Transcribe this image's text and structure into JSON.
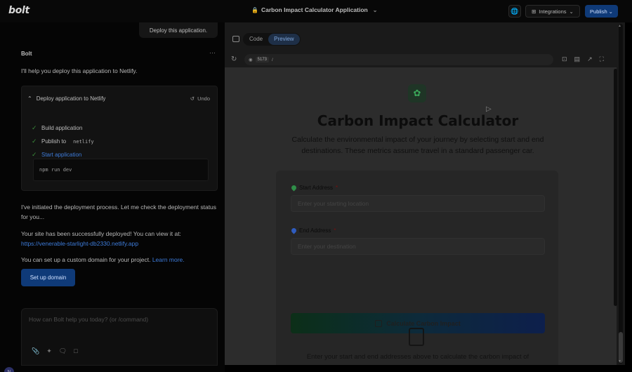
{
  "app": {
    "logo": "bolt"
  },
  "header": {
    "title": "Carbon Impact Calculator Application",
    "integrations_label": "Integrations",
    "publish_label": "Publish"
  },
  "chat": {
    "user_message": "Deploy this application.",
    "assistant_name": "Bolt",
    "intro": "I'll help you deploy this application to Netlify.",
    "action_card": {
      "title": "Deploy application to Netlify",
      "undo_label": "Undo",
      "steps": [
        {
          "label": "Build application",
          "code": ""
        },
        {
          "label": "Publish to",
          "code": "netlify"
        },
        {
          "label": "Start application",
          "code": ""
        }
      ],
      "command": "npm run dev"
    },
    "msg_initiated": "I've initiated the deployment process. Let me check the deployment status for you...",
    "msg_success": "Your site has been successfully deployed! You can view it at:",
    "site_url": "https://venerable-starlight-db2330.netlify.app",
    "msg_domain_prefix": "You can set up a custom domain for your project.",
    "learn_more": "Learn more.",
    "setup_domain_button": "Set up domain",
    "composer_placeholder": "How can Bolt help you today? (or /command)",
    "avatar_initial": "N"
  },
  "preview": {
    "tabs": [
      "Code",
      "Preview"
    ],
    "active_tab": "Preview",
    "port": "5173",
    "path": "/"
  },
  "page": {
    "title": "Carbon Impact Calculator",
    "subtitle": "Calculate the environmental impact of your journey by selecting start and end destinations. These metrics assume travel in a standard passenger car.",
    "start_label": "Start Address",
    "start_placeholder": "Enter your starting location",
    "end_label": "End Address",
    "end_placeholder": "Enter your destination",
    "required_mark": "*",
    "calc_button": "Calculate Carbon Impact",
    "result_hint": "Enter your start and end addresses above to calculate the carbon impact of"
  },
  "icons": {
    "lock": "lock-icon",
    "globe": "globe-icon",
    "leaf": "leaf-icon",
    "check": "check-icon",
    "undo": "undo-icon",
    "reload": "reload-icon"
  },
  "colors": {
    "accent_blue": "#0f3a78",
    "link": "#3d7bd9",
    "check_green": "#3a8a3a"
  }
}
